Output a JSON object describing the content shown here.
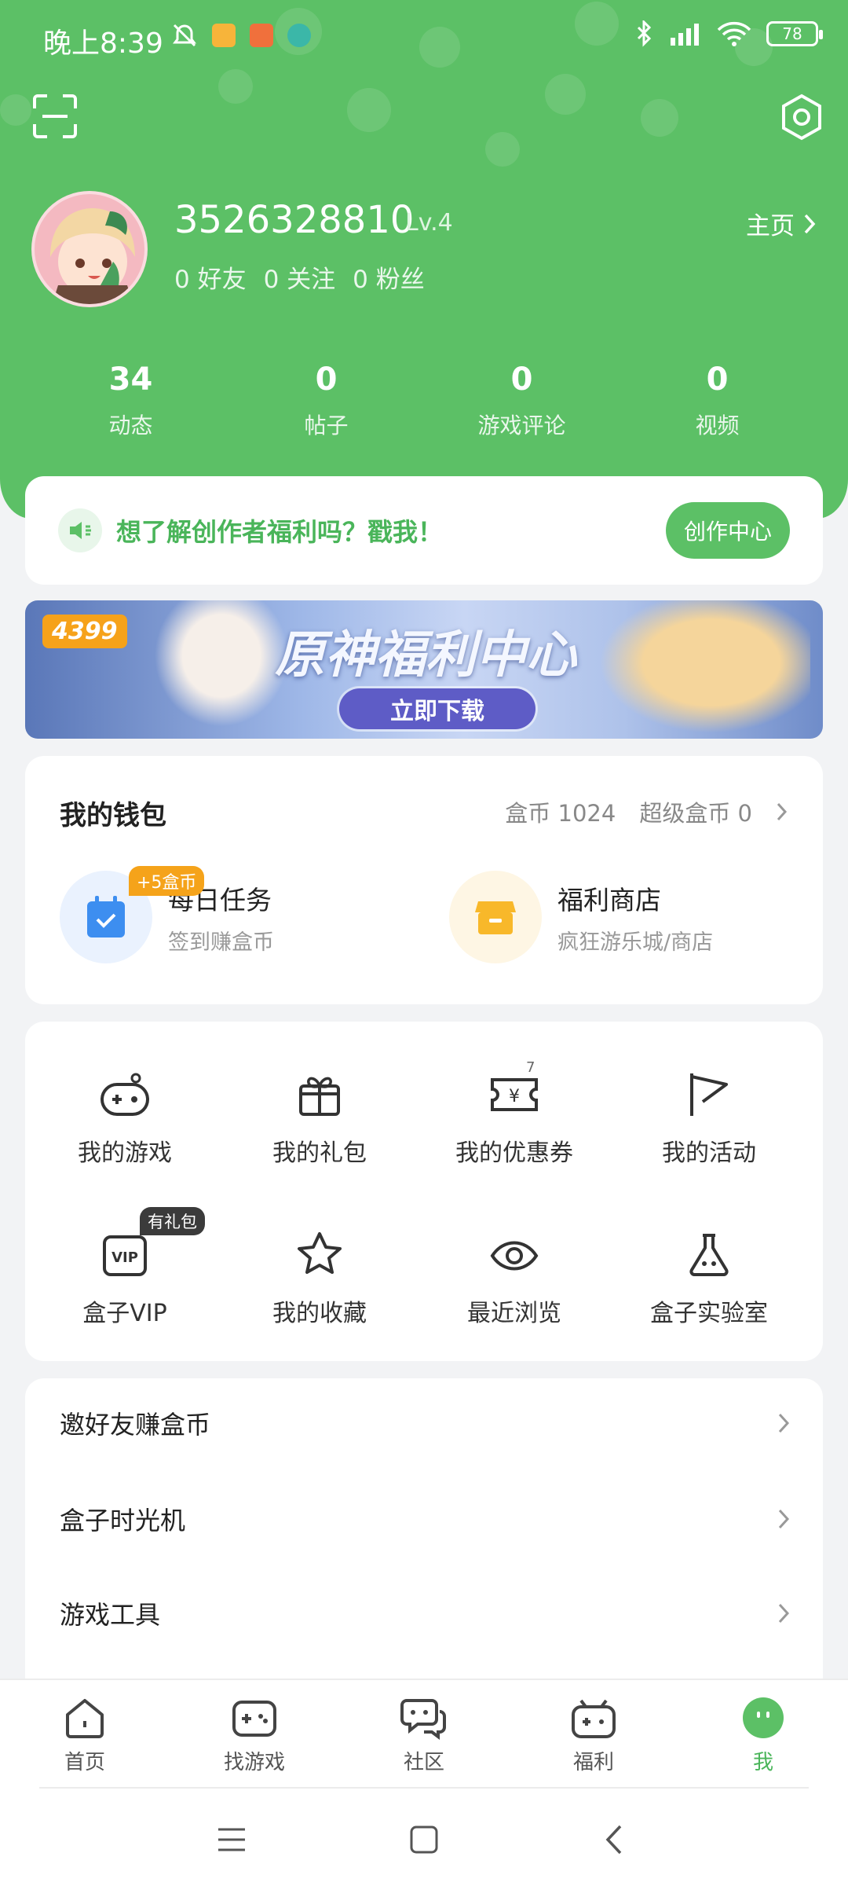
{
  "status_bar": {
    "time": "晚上8:39",
    "battery": "78"
  },
  "profile": {
    "username": "3526328810",
    "level": "Lv.4",
    "friends": "0 好友",
    "following": "0 关注",
    "fans": "0 粉丝",
    "homepage_label": "主页"
  },
  "stats": [
    {
      "num": "34",
      "label": "动态"
    },
    {
      "num": "0",
      "label": "帖子"
    },
    {
      "num": "0",
      "label": "游戏评论"
    },
    {
      "num": "0",
      "label": "视频"
    }
  ],
  "promo": {
    "text": "想了解创作者福利吗？戳我！",
    "button": "创作中心"
  },
  "banner": {
    "logo": "4399",
    "title": "原神福利中心",
    "button": "立即下载"
  },
  "wallet": {
    "title": "我的钱包",
    "coins": "盒币 1024",
    "super_coins": "超级盒币 0",
    "daily": {
      "title": "每日任务",
      "subtitle": "签到赚盒币",
      "tag": "+5盒币"
    },
    "shop": {
      "title": "福利商店",
      "subtitle": "疯狂游乐城/商店"
    }
  },
  "grid": [
    {
      "label": "我的游戏",
      "icon": "gamepad-icon"
    },
    {
      "label": "我的礼包",
      "icon": "gift-icon"
    },
    {
      "label": "我的优惠券",
      "icon": "coupon-icon",
      "badge": "7"
    },
    {
      "label": "我的活动",
      "icon": "flag-icon"
    },
    {
      "label": "盒子VIP",
      "icon": "vip-icon",
      "tag": "有礼包"
    },
    {
      "label": "我的收藏",
      "icon": "star-icon"
    },
    {
      "label": "最近浏览",
      "icon": "eye-icon"
    },
    {
      "label": "盒子实验室",
      "icon": "flask-icon"
    }
  ],
  "list": [
    {
      "label": "邀好友赚盒币"
    },
    {
      "label": "盒子时光机"
    },
    {
      "label": "游戏工具"
    }
  ],
  "tabs": [
    {
      "label": "首页"
    },
    {
      "label": "找游戏"
    },
    {
      "label": "社区"
    },
    {
      "label": "福利"
    },
    {
      "label": "我"
    }
  ],
  "colors": {
    "brand": "#5cc066",
    "brand_text": "#4ab55a",
    "coin_tag": "#f5a31a"
  }
}
